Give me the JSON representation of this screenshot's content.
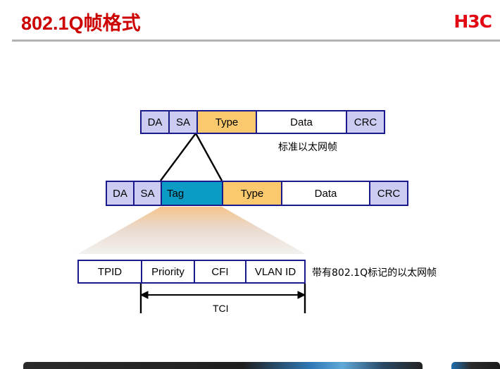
{
  "header": {
    "title": "802.1Q帧格式",
    "logo": "H3C",
    "title_color": "#cc0000",
    "logo_color": "#e30613",
    "divider_color": "#b3b3b3"
  },
  "colors": {
    "border": "#1a1a8c",
    "address_field": "#ccccf2",
    "type_field": "#fac96e",
    "tag_field": "#0b9bc4",
    "data_field": "#ffffff",
    "callout_gradient_top": "#f5c48b",
    "callout_gradient_bottom": "#f2f0ee"
  },
  "diagram": {
    "standard_frame": {
      "caption": "标准以太网帧",
      "fields": [
        {
          "label": "DA",
          "style": "addr"
        },
        {
          "label": "SA",
          "style": "addr"
        },
        {
          "label": "Type",
          "style": "type"
        },
        {
          "label": "Data",
          "style": "data"
        },
        {
          "label": "CRC",
          "style": "addr"
        }
      ]
    },
    "tagged_frame": {
      "caption": "带有802.1Q标记的以太网帧",
      "fields": [
        {
          "label": "DA",
          "style": "addr"
        },
        {
          "label": "SA",
          "style": "addr"
        },
        {
          "label": "Tag",
          "style": "tag"
        },
        {
          "label": "Type",
          "style": "type"
        },
        {
          "label": "Data",
          "style": "data"
        },
        {
          "label": "CRC",
          "style": "addr"
        }
      ]
    },
    "tag_detail": {
      "fields": [
        {
          "label": "TPID"
        },
        {
          "label": "Priority"
        },
        {
          "label": "CFI"
        },
        {
          "label": "VLAN ID"
        }
      ],
      "span_label": "TCI"
    }
  }
}
